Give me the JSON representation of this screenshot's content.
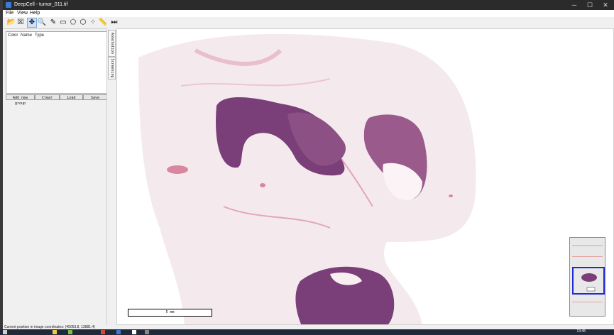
{
  "window": {
    "title": "DeepCell - tumor_011.tif"
  },
  "window_controls": {
    "minimize": "─",
    "maximize": "☐",
    "close": "✕"
  },
  "menu": [
    "File",
    "View",
    "Help"
  ],
  "toolbar": [
    {
      "name": "open-file-icon",
      "glyph": "📂"
    },
    {
      "name": "close-file-icon",
      "glyph": "☒"
    },
    {
      "name": "pan-tool-icon",
      "glyph": "✥"
    },
    {
      "name": "zoom-tool-icon",
      "glyph": "🔍"
    },
    {
      "name": "pen-tool-icon",
      "glyph": "✎"
    },
    {
      "name": "rectangle-tool-icon",
      "glyph": "▭"
    },
    {
      "name": "polygon-tool-icon",
      "glyph": "⬠"
    },
    {
      "name": "polygon-edit-icon",
      "glyph": "⬡"
    },
    {
      "name": "points-tool-icon",
      "glyph": "⁘"
    },
    {
      "name": "ruler-tool-icon",
      "glyph": "📏"
    },
    {
      "name": "play-step-icon",
      "glyph": "⏭"
    }
  ],
  "annotation_panel": {
    "columns": [
      "Color",
      "Name",
      "Type"
    ]
  },
  "panel_buttons": [
    "Add new group",
    "Clear",
    "Load",
    "Save"
  ],
  "side_tabs": [
    "Annotation",
    "Screening"
  ],
  "scale_bar": {
    "label": "5 mm"
  },
  "status": {
    "text": "Current position in image coordinates: (45053.8, 13881.4)"
  },
  "clock": {
    "time": "13:45"
  },
  "colors": {
    "titlebar": "#2b2b2b",
    "tissue_dark": "#7a3f78",
    "tissue_light": "#e8b7c8",
    "viewport_box": "#1f2bd6"
  }
}
